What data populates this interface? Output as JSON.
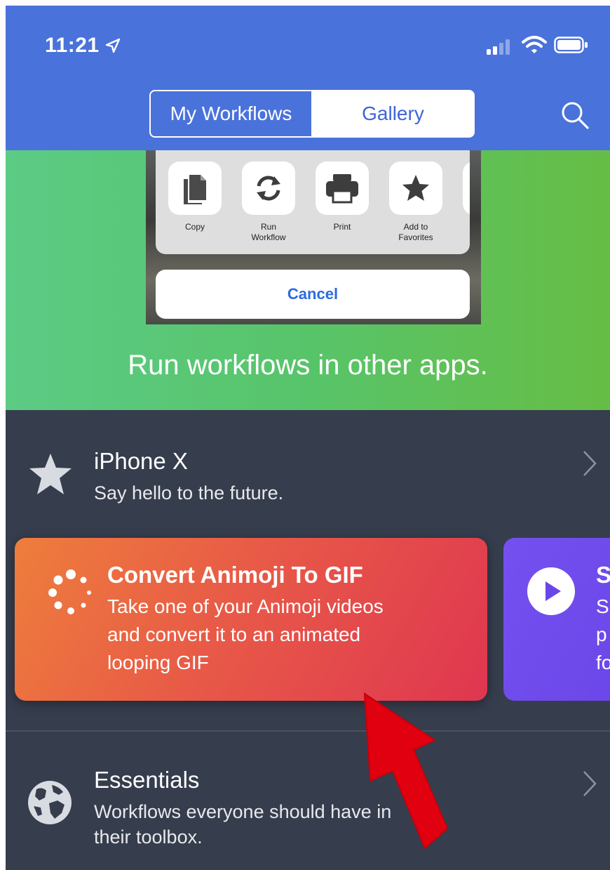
{
  "status_bar": {
    "time": "11:21"
  },
  "nav": {
    "segments": [
      "My Workflows",
      "Gallery"
    ],
    "selected": "Gallery"
  },
  "banner": {
    "share_actions": [
      {
        "label_line1": "Copy",
        "label_line2": ""
      },
      {
        "label_line1": "Run",
        "label_line2": "Workflow"
      },
      {
        "label_line1": "Print",
        "label_line2": ""
      },
      {
        "label_line1": "Add to",
        "label_line2": "Favorites"
      }
    ],
    "cancel_label": "Cancel",
    "headline": "Run workflows in other apps."
  },
  "collections": [
    {
      "title": "iPhone X",
      "subtitle": "Say hello to the future.",
      "icon": "star-icon"
    },
    {
      "title": "Essentials",
      "subtitle_line1": "Workflows everyone should have in",
      "subtitle_line2": "their toolbox.",
      "icon": "globe-icon"
    }
  ],
  "cards": [
    {
      "title": "Convert Animoji To GIF",
      "desc_line1": "Take one of your Animoji videos",
      "desc_line2": "and convert it to an animated",
      "desc_line3": "looping GIF",
      "icon": "spinner-icon",
      "color": "#e85a47"
    },
    {
      "title": "S",
      "desc_line1": "S",
      "desc_line2": "p",
      "desc_line3": "fo",
      "icon": "play-icon",
      "color": "#6a46e8"
    }
  ],
  "colors": {
    "header": "#4a72db",
    "background": "#363d4d",
    "accent": "#3e66d6"
  }
}
